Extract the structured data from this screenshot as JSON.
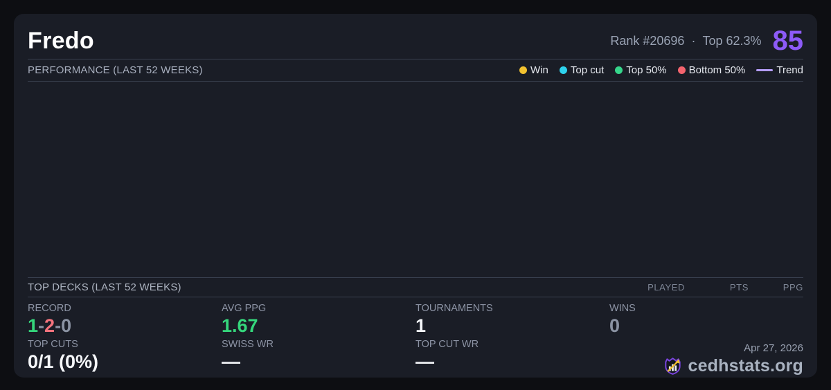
{
  "header": {
    "title": "Fredo",
    "rank": "Rank #20696",
    "dot": "·",
    "top_percent": "Top 62.3%",
    "score": "85"
  },
  "performance": {
    "heading": "PERFORMANCE (LAST 52 WEEKS)",
    "legend": [
      {
        "label": "Win",
        "color": "#f2c230",
        "marker": "dot"
      },
      {
        "label": "Top cut",
        "color": "#2ed3ee",
        "marker": "dot"
      },
      {
        "label": "Top 50%",
        "color": "#36d68b",
        "marker": "dot"
      },
      {
        "label": "Bottom 50%",
        "color": "#f4646e",
        "marker": "dot"
      },
      {
        "label": "Trend",
        "color": "#b49df8",
        "marker": "line"
      }
    ]
  },
  "chart_data": {
    "type": "scatter",
    "title": "PERFORMANCE (LAST 52 WEEKS)",
    "series": [],
    "note_visible_points": 0,
    "legend_entries": [
      "Win",
      "Top cut",
      "Top 50%",
      "Bottom 50%",
      "Trend"
    ],
    "legend_position": "top-right",
    "grid": false
  },
  "top_decks": {
    "heading": "TOP DECKS (LAST 52 WEEKS)",
    "columns": [
      "PLAYED",
      "PTS",
      "PPG"
    ],
    "rows": []
  },
  "stats": {
    "record": {
      "label": "RECORD",
      "wins": "1",
      "losses": "2",
      "draws": "0",
      "separator": "-"
    },
    "avg_ppg": {
      "label": "AVG PPG",
      "value": "1.67"
    },
    "tournaments": {
      "label": "TOURNAMENTS",
      "value": "1"
    },
    "wins": {
      "label": "WINS",
      "value": "0"
    },
    "top_cuts": {
      "label": "TOP CUTS",
      "value": "0/1 (0%)"
    },
    "swiss_wr": {
      "label": "SWISS WR",
      "value": "—"
    },
    "top_cut_wr": {
      "label": "TOP CUT WR",
      "value": "—"
    }
  },
  "footer": {
    "date": "Apr 27, 2026",
    "brand": "cedhstats.org"
  },
  "colors": {
    "background": "#0d0e12",
    "card": "#1a1d26",
    "divider": "#3a4150",
    "accent_purple": "#8d5bf7",
    "win_yellow": "#f2c230",
    "topcut_cyan": "#2ed3ee",
    "top50_green": "#36d68b",
    "bottom50_red": "#f4646e",
    "trend_purple": "#b49df8",
    "positive_green": "#35d77c",
    "negative_red": "#f4737d",
    "muted_gray": "#8b93a3"
  }
}
